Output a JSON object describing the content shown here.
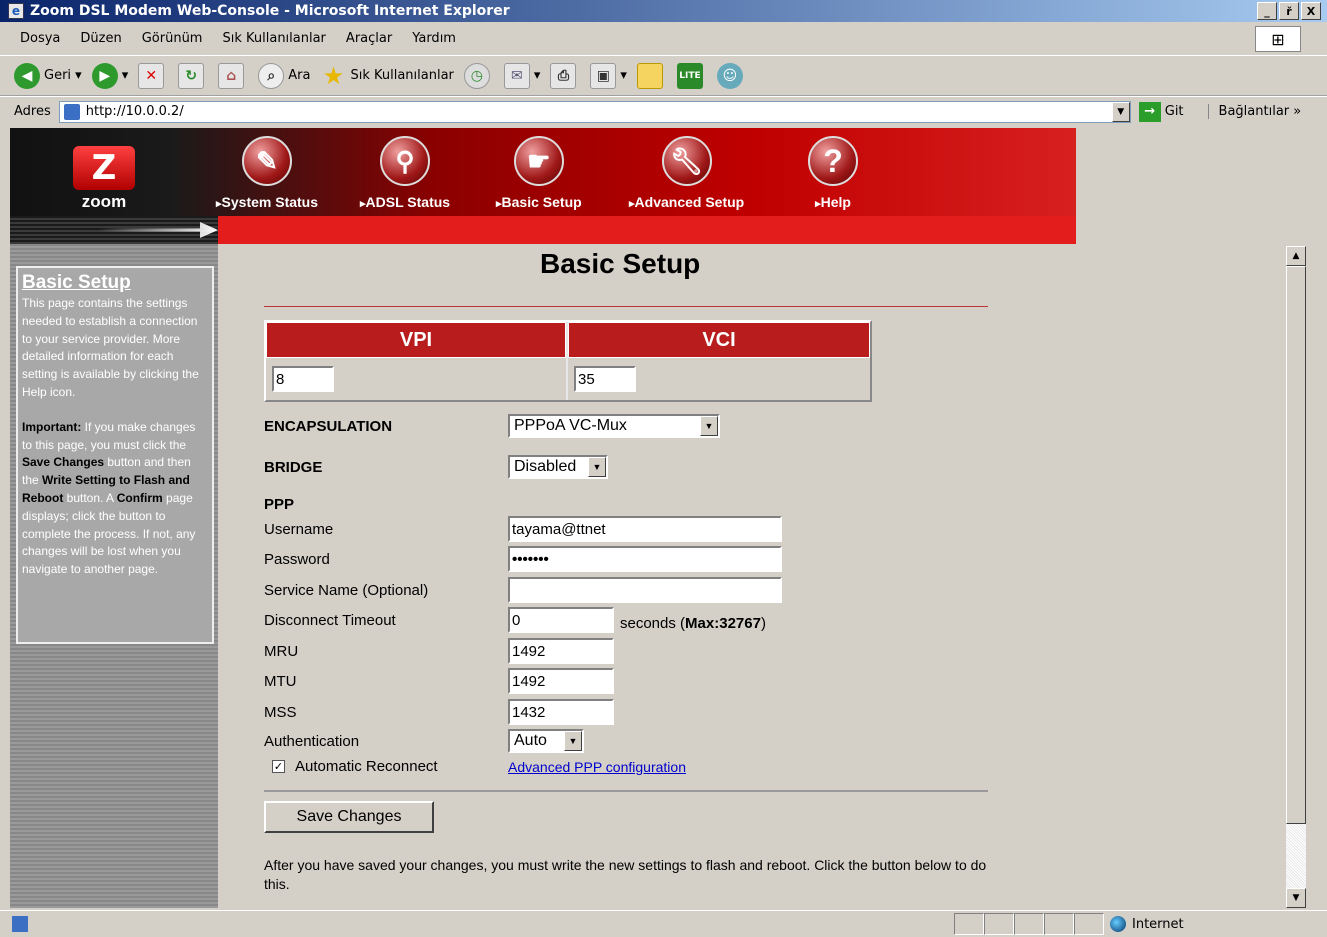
{
  "window": {
    "title": "Zoom DSL Modem Web-Console - Microsoft Internet Explorer",
    "minimize": "_",
    "maximize": "ř",
    "close": "X"
  },
  "menu": [
    "Dosya",
    "Düzen",
    "Görünüm",
    "Sık Kullanılanlar",
    "Araçlar",
    "Yardım"
  ],
  "toolbar": {
    "back": "Geri",
    "search": "Ara",
    "favorites": "Sık Kullanılanlar"
  },
  "address": {
    "label": "Adres",
    "url": "http://10.0.0.2/",
    "go": "Git",
    "links": "Bağlantılar"
  },
  "nav": {
    "logo": "zoom",
    "items": [
      "System Status",
      "ADSL Status",
      "Basic Setup",
      "Advanced Setup",
      "Help"
    ]
  },
  "sidebar": {
    "title": "Basic Setup",
    "intro": "This page contains the settings needed to establish a connection to your service provider. More detailed information for each setting is available by clicking the Help icon.",
    "important_label": "Important:",
    "important_1": " If you make changes to this page, you must click the ",
    "save_changes": "Save Changes",
    "important_2": " button and then the ",
    "write_setting": "Write Setting to Flash and Reboot",
    "important_3": " button. A ",
    "confirm": "Confirm",
    "important_4": " page displays; click the button to complete the process. If not, any changes will be lost when you navigate to another page."
  },
  "page": {
    "title": "Basic Setup",
    "vpi_label": "VPI",
    "vpi_value": "8",
    "vci_label": "VCI",
    "vci_value": "35",
    "encapsulation_label": "ENCAPSULATION",
    "encapsulation_value": "PPPoA VC-Mux",
    "bridge_label": "BRIDGE",
    "bridge_value": "Disabled",
    "ppp_label": "PPP",
    "username_label": "Username",
    "username_value": "tayama@ttnet",
    "password_label": "Password",
    "password_value": "•••••••",
    "service_label": "Service Name (Optional)",
    "service_value": "",
    "timeout_label": "Disconnect Timeout",
    "timeout_value": "0",
    "timeout_unit": "seconds (",
    "timeout_max": "Max:32767",
    "timeout_close": ")",
    "mru_label": "MRU",
    "mru_value": "1492",
    "mtu_label": "MTU",
    "mtu_value": "1492",
    "mss_label": "MSS",
    "mss_value": "1432",
    "auth_label": "Authentication",
    "auth_value": "Auto",
    "reconnect_label": "Automatic Reconnect",
    "reconnect_checked": "✓",
    "advanced_link": "Advanced PPP configuration",
    "save_button": "Save Changes",
    "note": "After you have saved your changes, you must write the new settings to flash and reboot. Click the button below to do this."
  },
  "status": {
    "zone": "Internet"
  }
}
